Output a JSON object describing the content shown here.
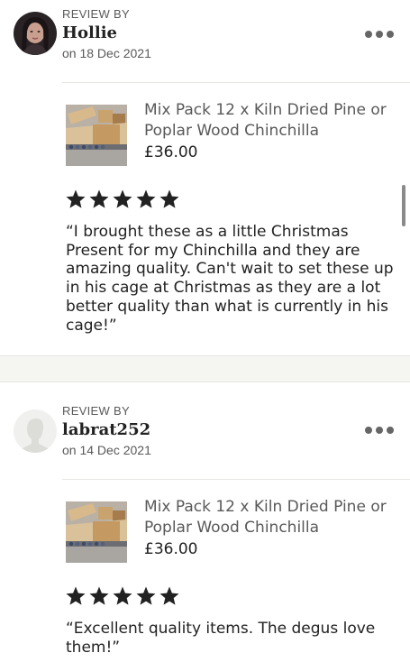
{
  "reviews": [
    {
      "eyebrow": "REVIEW BY",
      "author": "Hollie",
      "date": "on 18 Dec 2021",
      "product": {
        "title": "Mix Pack 12 x Kiln Dried Pine or Poplar Wood Chinchilla",
        "price": "£36.00"
      },
      "rating": 5,
      "text": "“I brought these as a little Christmas Present for my Chinchilla and they are amazing quality. Can't wait to set these up in his cage at Christmas as they are a lot better quality than what is currently in his cage!”"
    },
    {
      "eyebrow": "REVIEW BY",
      "author": "labrat252",
      "date": "on 14 Dec 2021",
      "product": {
        "title": "Mix Pack 12 x Kiln Dried Pine or Poplar Wood Chinchilla",
        "price": "£36.00"
      },
      "rating": 5,
      "text": "“Excellent quality items. The degus love them!”"
    }
  ],
  "icons": {
    "more": "more-dots-icon",
    "star": "star-icon",
    "avatar_default": "user-silhouette-icon"
  },
  "colors": {
    "text": "#222222",
    "muted": "#595959",
    "star": "#222222",
    "divider_band": "#f5f5f1"
  }
}
